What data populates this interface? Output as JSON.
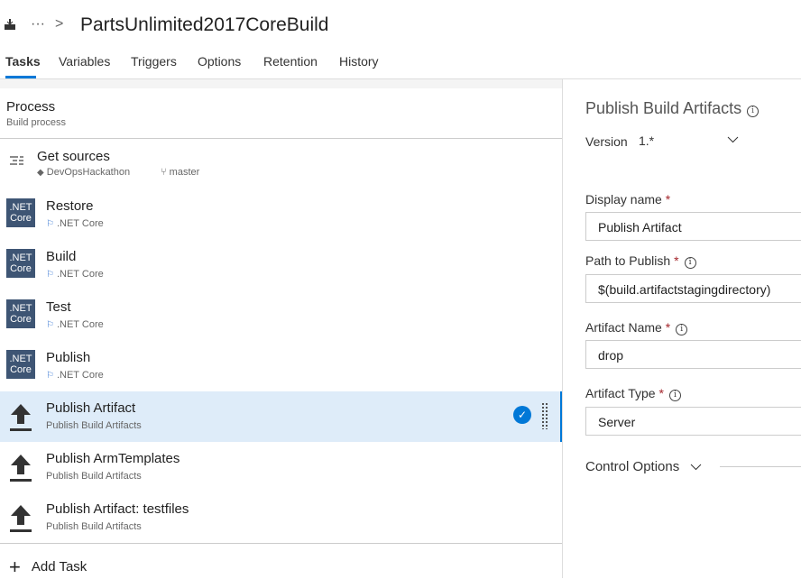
{
  "header": {
    "ellipsis": "···",
    "separator": ">",
    "title": "PartsUnlimited2017CoreBuild"
  },
  "tabs": [
    "Tasks",
    "Variables",
    "Triggers",
    "Options",
    "Retention",
    "History"
  ],
  "process": {
    "title": "Process",
    "subtitle": "Build process"
  },
  "get_sources": {
    "name": "Get sources",
    "repo": "DevOpsHackathon",
    "branch": "master"
  },
  "tasks": [
    {
      "name": "Restore",
      "sub": ".NET Core",
      "icon": "dotnet",
      "icon_text": [
        ".NET",
        "Core"
      ]
    },
    {
      "name": "Build",
      "sub": ".NET Core",
      "icon": "dotnet",
      "icon_text": [
        ".NET",
        "Core"
      ]
    },
    {
      "name": "Test",
      "sub": ".NET Core",
      "icon": "dotnet",
      "icon_text": [
        ".NET",
        "Core"
      ]
    },
    {
      "name": "Publish",
      "sub": ".NET Core",
      "icon": "dotnet",
      "icon_text": [
        ".NET",
        "Core"
      ]
    },
    {
      "name": "Publish Artifact",
      "sub": "Publish Build Artifacts",
      "icon": "upload",
      "selected": true
    },
    {
      "name": "Publish ArmTemplates",
      "sub": "Publish Build Artifacts",
      "icon": "upload"
    },
    {
      "name": "Publish Artifact: testfiles",
      "sub": "Publish Build Artifacts",
      "icon": "upload"
    }
  ],
  "add_task": "Add Task",
  "details": {
    "title": "Publish Build Artifacts",
    "version_label": "Version",
    "version_value": "1.*",
    "display_name_label": "Display name",
    "display_name": "Publish Artifact",
    "path_label": "Path to Publish",
    "path": "$(build.artifactstagingdirectory)",
    "artifact_name_label": "Artifact Name",
    "artifact_name": "drop",
    "artifact_type_label": "Artifact Type",
    "artifact_type": "Server",
    "required_mark": "*",
    "control_options": "Control Options"
  },
  "colors": {
    "accent": "#0078d7",
    "selected_row": "#deecf9",
    "dotnet": "#3e5574"
  }
}
